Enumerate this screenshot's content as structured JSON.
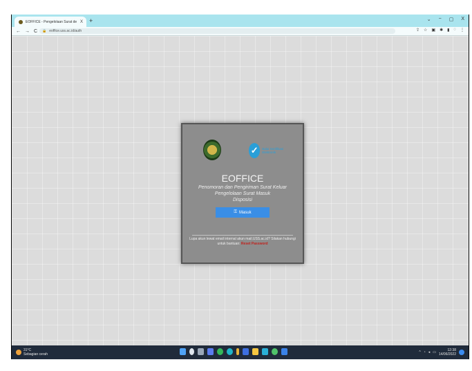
{
  "browser": {
    "tab_title": "EOFFICE - Pengelolaan Surat de",
    "tab_close": "X",
    "new_tab": "+",
    "url": "eoffice.uss.ac.id/auth",
    "back": "←",
    "forward": "→",
    "reload": "C",
    "window_controls": [
      "⌄",
      "−",
      "▢",
      "X"
    ]
  },
  "login_card": {
    "logo_partner_text": "Balai Sertifikasi Elektronik",
    "app_title": "EOFFICE",
    "subtitle_lines": [
      "Penomoran dan Pengiriman Surat Keluar",
      "Pengelolaan Surat Masuk",
      "Disposisi"
    ],
    "login_button": "Masuk",
    "forgot_text": "Lupa akun lewat email internal akun mail.USS.ac.id? Silakan hubungi untuk bantuan:",
    "reset_link": "Reset Password"
  },
  "taskbar": {
    "weather_temp": "31°C",
    "weather_desc": "Sebagian cerah",
    "time": "12:38",
    "date": "14/06/2022"
  },
  "colors": {
    "tabstrip": "#a9e4ee",
    "login_button": "#3a8ee6",
    "reset_link": "#c0221c",
    "taskbar": "#202b3b"
  }
}
